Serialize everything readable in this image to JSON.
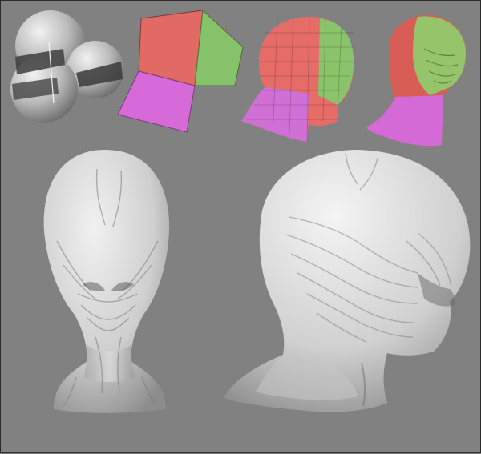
{
  "scene": {
    "background_color": "#818181",
    "stages": [
      {
        "id": "sphere-cluster",
        "colors": {
          "base": "#b9b9b9",
          "dark": "#4a4a4a"
        }
      },
      {
        "id": "color-planes",
        "colors": {
          "red": "#e26a64",
          "green": "#86c26a",
          "magenta": "#d66ad8"
        }
      },
      {
        "id": "lowpoly-head",
        "colors": {
          "red": "#e66c68",
          "green": "#8ac46a",
          "magenta": "#d070d6"
        }
      },
      {
        "id": "sculpted-colored-head",
        "colors": {
          "red": "#d85d55",
          "green": "#95c46a",
          "magenta": "#d46ad6"
        }
      },
      {
        "id": "alien-head-front",
        "colors": {
          "base": "#d9d9d9"
        }
      },
      {
        "id": "alien-head-side",
        "colors": {
          "base": "#d7d7d7"
        }
      }
    ]
  }
}
